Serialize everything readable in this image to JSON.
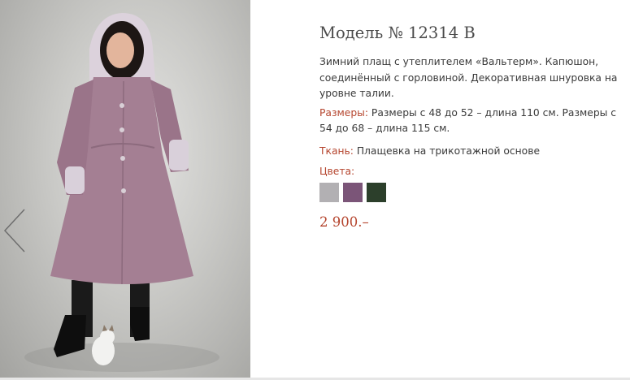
{
  "product": {
    "title": "Модель № 12314 В",
    "description": "Зимний плащ  с утеплителем «Вальтерм». Капюшон, соединённый  с горловиной. Декоративная шнуровка на уровне талии.",
    "sizes_label": "Размеры:",
    "sizes_value": " Размеры с 48 до 52 – длина 110 см. Размеры с 54 до 68 – длина 115 см.",
    "fabric_label": "Ткань:",
    "fabric_value": " Плащевка на трикотажной основе",
    "colors_label": "Цвета:",
    "colors": [
      {
        "name": "light-gray",
        "hex": "#b2b0b3"
      },
      {
        "name": "mauve",
        "hex": "#7b5578"
      },
      {
        "name": "dark-green",
        "hex": "#2c3f2b"
      }
    ],
    "price": "2 900.–"
  },
  "gallery": {
    "prev_icon": "chevron-left-icon"
  },
  "theme": {
    "accent": "#b5452e",
    "coat": "#a47f93"
  }
}
